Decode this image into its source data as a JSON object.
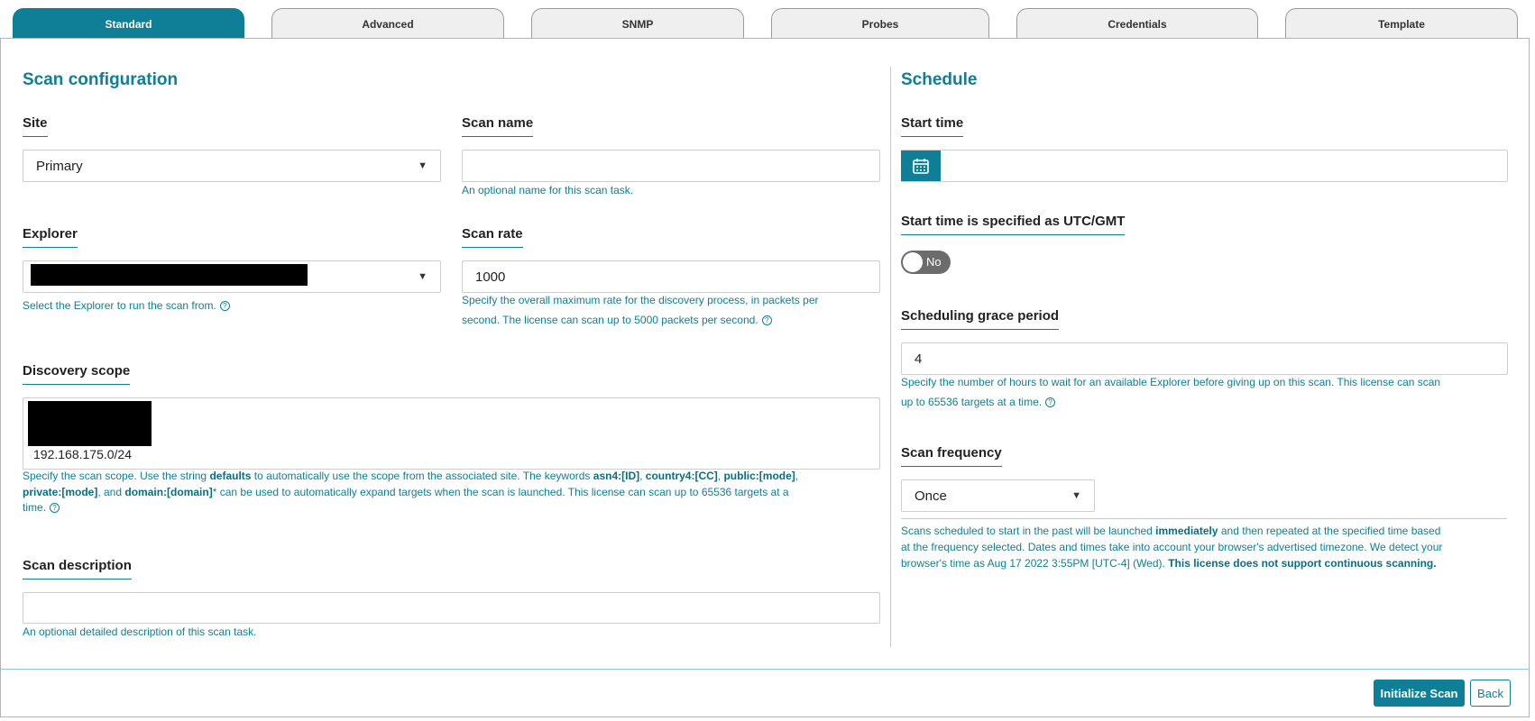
{
  "tabs": [
    "Standard",
    "Advanced",
    "SNMP",
    "Probes",
    "Credentials",
    "Template"
  ],
  "scan_config": {
    "title": "Scan configuration",
    "site_label": "Site",
    "site_value": "Primary",
    "scan_name_label": "Scan name",
    "scan_name_value": "",
    "scan_name_help": "An optional name for this scan task.",
    "explorer_label": "Explorer",
    "explorer_help": "Select the Explorer to run the scan from.",
    "scan_rate_label": "Scan rate",
    "scan_rate_value": "1000",
    "scan_rate_help_1": "Specify the overall maximum rate for the discovery process, in packets per",
    "scan_rate_help_2": "second. The license can scan up to 5000 packets per second.",
    "discovery_scope_label": "Discovery scope",
    "discovery_scope_value": "192.168.175.0/24",
    "scope_help": {
      "p1": "Specify the scan scope. Use the string ",
      "k1": "defaults",
      "p2": " to automatically use the scope from the associated site. The keywords ",
      "k2": "asn4:[ID]",
      "p3": ", ",
      "k3": "country4:[CC]",
      "p4": ", ",
      "k4": "public:[mode]",
      "p5": ",",
      "k5": "private:[mode]",
      "p6": ", and ",
      "k6": "domain:[domain]",
      "p7": "* can be used to automatically expand targets when the scan is launched. This license can scan up to 65536 targets at a",
      "p8": "time."
    },
    "scan_description_label": "Scan description",
    "scan_description_value": "",
    "scan_description_help": "An optional detailed description of this scan task."
  },
  "schedule": {
    "title": "Schedule",
    "start_time_label": "Start time",
    "start_time_value": "",
    "utc_label": "Start time is specified as UTC/GMT",
    "utc_toggle": "No",
    "grace_label": "Scheduling grace period",
    "grace_value": "4",
    "grace_help_1": "Specify the number of hours to wait for an available Explorer before giving up on this scan. This license can scan",
    "grace_help_2": "up to 65536 targets at a time.",
    "frequency_label": "Scan frequency",
    "frequency_value": "Once",
    "freq_help": {
      "p1": "Scans scheduled to start in the past will be launched ",
      "k1": "immediately",
      "p2": " and then repeated at the specified time based",
      "p3": "at the frequency selected. Dates and times take into account your browser's advertised timezone. We detect your",
      "p4": "browser's time as Aug 17 2022 3:55PM [UTC-4] (Wed). ",
      "k2": "This license does not support continuous scanning."
    }
  },
  "buttons": {
    "initialize": "Initialize Scan",
    "back": "Back"
  },
  "colors": {
    "accent": "#0e7f96",
    "toggle_off": "#6c6c6c"
  },
  "icons": {
    "help": "question-circle-icon",
    "calendar": "calendar-icon",
    "dropdown": "chevron-down-icon"
  }
}
